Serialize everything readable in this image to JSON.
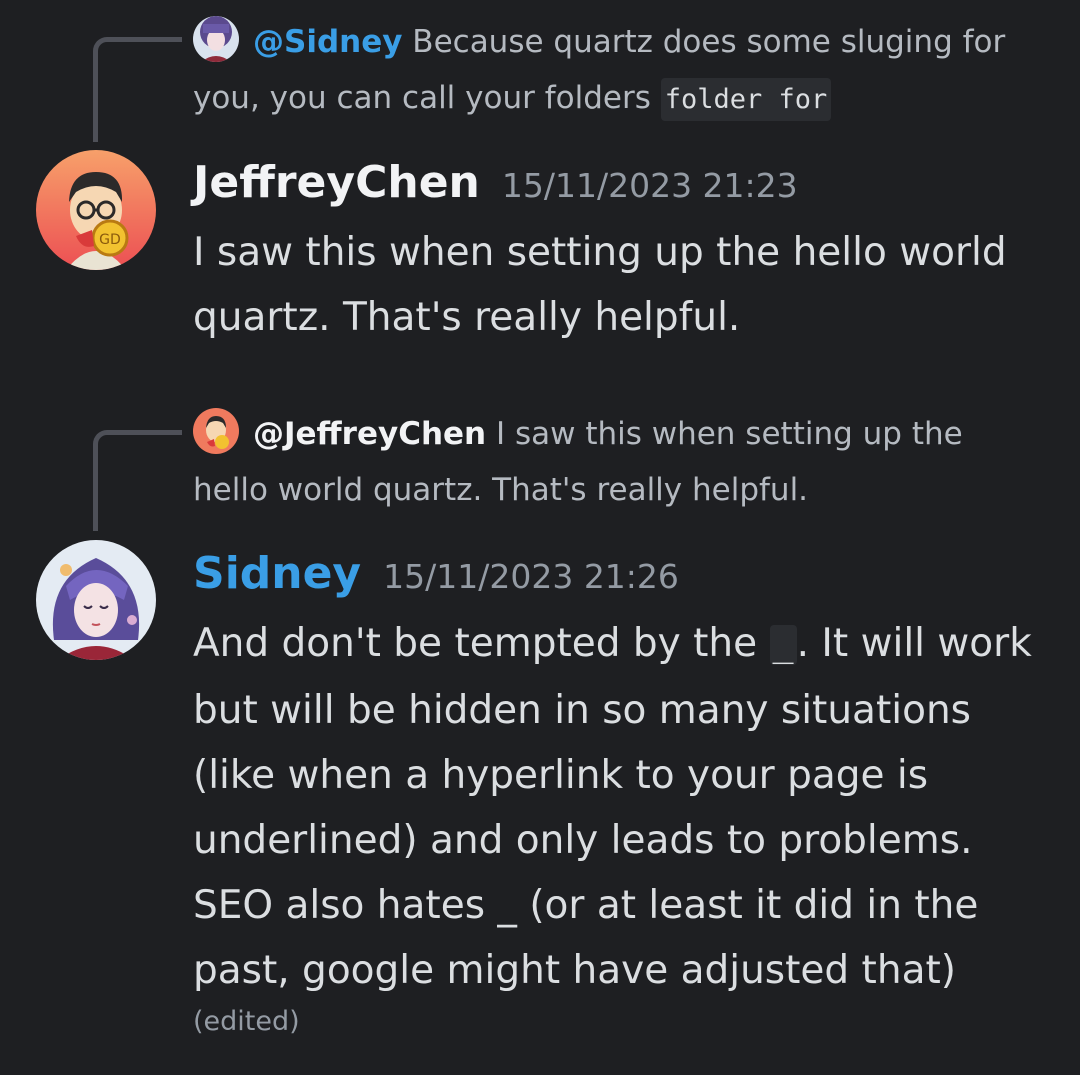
{
  "messages": [
    {
      "reply": {
        "mention": "@Sidney",
        "text_1": " Because quartz does some sluging for you, you can call your folders ",
        "code": "folder for"
      },
      "username": "JeffreyChen",
      "timestamp": "15/11/2023 21:23",
      "content": "I saw this when setting up the hello world quartz. That's really helpful."
    },
    {
      "reply": {
        "mention": "@JeffreyChen",
        "text_1": " I saw this when setting up the hello world quartz. That's really helpful."
      },
      "username": "Sidney",
      "timestamp": "15/11/2023 21:26",
      "content_before_code": "And don't be tempted by the ",
      "code": "_",
      "content_after_code": ". It will work but will be hidden in so many situations (like when a hyperlink to your page is underlined) and only leads to problems. SEO also hates _ (or at least it did in the past, google might have adjusted that)",
      "edited_label": "(edited)"
    }
  ],
  "colors": {
    "background": "#1e1f22",
    "mention_blue": "#3a9ee6",
    "muted_text": "#949ba4",
    "body_text": "#dbdee1"
  },
  "icons": {
    "jeffrey_avatar": "cartoon-man-with-glasses-avatar",
    "sidney_avatar": "anime-girl-portrait-avatar"
  }
}
